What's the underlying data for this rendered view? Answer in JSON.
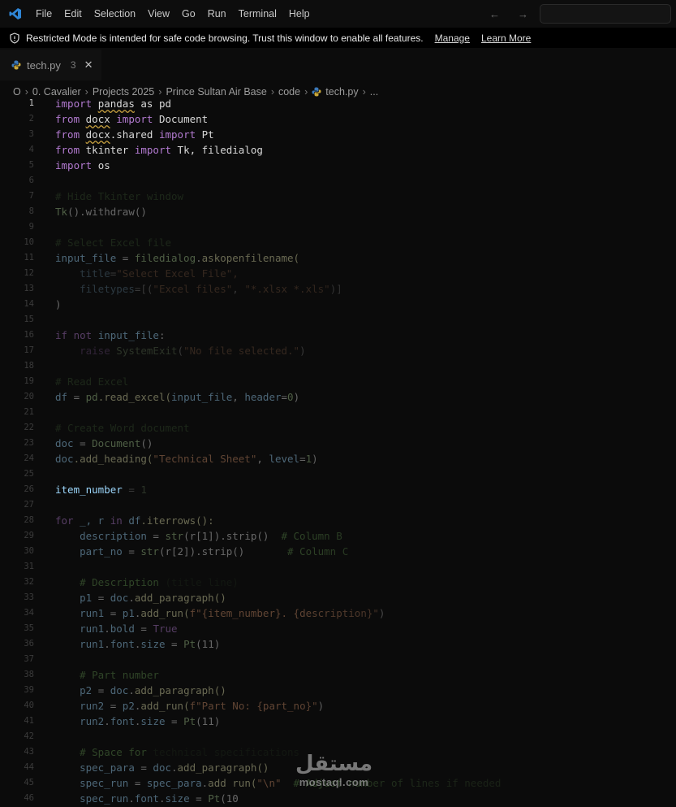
{
  "menu": [
    "File",
    "Edit",
    "Selection",
    "View",
    "Go",
    "Run",
    "Terminal",
    "Help"
  ],
  "nav": {
    "back": "←",
    "forward": "→"
  },
  "banner": {
    "message": "Restricted Mode is intended for safe code browsing. Trust this window to enable all features.",
    "manage": "Manage",
    "learn_more": "Learn More"
  },
  "tab": {
    "name": "tech.py",
    "badge": "3",
    "close": "✕"
  },
  "breadcrumb": [
    "0. Cavalier",
    "Projects 2025",
    "Prince Sultan Air Base",
    "code",
    "tech.py",
    "..."
  ],
  "breadcrumb_lead": "O",
  "line_numbers": [
    "1",
    "2",
    "3",
    "4",
    "5",
    "6",
    "7",
    "8",
    "9",
    "10",
    "11",
    "12",
    "13",
    "14",
    "15",
    "16",
    "17",
    "18",
    "19",
    "20",
    "21",
    "22",
    "23",
    "24",
    "25",
    "26",
    "27",
    "28",
    "29",
    "30",
    "31",
    "32",
    "33",
    "34",
    "35",
    "36",
    "37",
    "38",
    "39",
    "40",
    "41",
    "42",
    "43",
    "44",
    "45",
    "46"
  ],
  "code": {
    "l1": [
      "import ",
      "pandas",
      " as pd"
    ],
    "l2": [
      "from ",
      "docx",
      " import ",
      "Document"
    ],
    "l3": [
      "from ",
      "docx",
      ".shared",
      " import ",
      "Pt"
    ],
    "l4": [
      "from ",
      "tkinter",
      " import ",
      "Tk, filedialog"
    ],
    "l5": [
      "import ",
      "os"
    ],
    "l7": "# Hide Tkinter window",
    "l8": [
      "Tk",
      "().withdraw()"
    ],
    "l10": "# Select Excel file",
    "l11": [
      "input_file",
      " = ",
      "filedialog",
      "askopenfilename("
    ],
    "l12": [
      "    ",
      "title",
      "=",
      "\"Select Excel File\","
    ],
    "l13": [
      "    ",
      "filetypes",
      "=[(",
      "\"Excel files\"",
      ", ",
      "\"*.xlsx *.xls\"",
      ")]"
    ],
    "l14": ")",
    "l16": [
      "if ",
      "not ",
      "input_file",
      ":"
    ],
    "l17": [
      "    ",
      "raise ",
      "SystemExit",
      "(",
      "\"No file selected.\"",
      ")"
    ],
    "l19": "# Read Excel",
    "l20": [
      "df",
      " = ",
      "pd",
      ".read_excel(",
      "input_file",
      ", ",
      "header",
      "=",
      "0",
      ")"
    ],
    "l22": "# Create Word document",
    "l23": [
      "doc",
      " = ",
      "Document",
      "()"
    ],
    "l24": [
      "doc",
      ".add_heading(",
      "\"Technical Sheet\"",
      ", ",
      "level",
      "=",
      "1",
      ")"
    ],
    "l26": [
      "item_number",
      " = ",
      "1"
    ],
    "l28": [
      "for ",
      "_, r",
      " in ",
      "df",
      ".iterrows():"
    ],
    "l29": [
      "    ",
      "description",
      " = ",
      "str",
      "(r[1]).strip()",
      "  # Column B"
    ],
    "l30": [
      "    ",
      "part_no",
      " = ",
      "str",
      "(r[2]).strip()",
      "       # Column C"
    ],
    "l32": [
      "    ",
      "# Description",
      " (title line)"
    ],
    "l33": [
      "    ",
      "p1",
      " = ",
      "doc",
      "add_paragraph()"
    ],
    "l34": [
      "    ",
      "run1",
      " = ",
      "p1",
      "add_run(",
      "f\"{item_number}. {description}\"",
      ")"
    ],
    "l35": [
      "    ",
      "run1",
      "bold",
      " = ",
      "True"
    ],
    "l36": [
      "    ",
      "run1",
      "font",
      "size",
      " = ",
      "Pt",
      "(11)"
    ],
    "l38": [
      "    ",
      "# Part number"
    ],
    "l39": [
      "    ",
      "p2",
      " = ",
      "doc",
      "add_paragraph()"
    ],
    "l40": [
      "    ",
      "run2",
      " = ",
      "p2",
      "add_run(",
      "f\"Part No: {part_no}\"",
      ")"
    ],
    "l41": [
      "    ",
      "run2",
      "font",
      "size",
      " = ",
      "Pt",
      "(11)"
    ],
    "l43": [
      "    ",
      "# Space for",
      " technical specifications"
    ],
    "l44": [
      "    ",
      "spec_para",
      " = ",
      "doc",
      "add_paragraph()"
    ],
    "l45": [
      "    ",
      "spec_run",
      " = ",
      "spec_para",
      "add run(",
      "\"\\n\"",
      "  # Adjust number of lines if needed"
    ],
    "l46": [
      "    ",
      "spec_run",
      "font",
      "size",
      " = ",
      "Pt",
      "(10"
    ]
  },
  "watermark": {
    "arabic": "مستقل",
    "latin": "mostaql.com"
  }
}
